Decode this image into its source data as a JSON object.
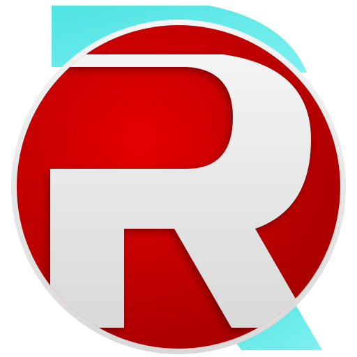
{
  "logo": {
    "icon": "letter-r-logo-icon",
    "colors": {
      "red": "#e60000",
      "red_dark": "#a80000",
      "teal": "#4fe3e3",
      "teal_light": "#7ff0f0",
      "white": "#f4f4f4",
      "white_shade": "#d9d9d9",
      "background": "#ffffff"
    }
  }
}
